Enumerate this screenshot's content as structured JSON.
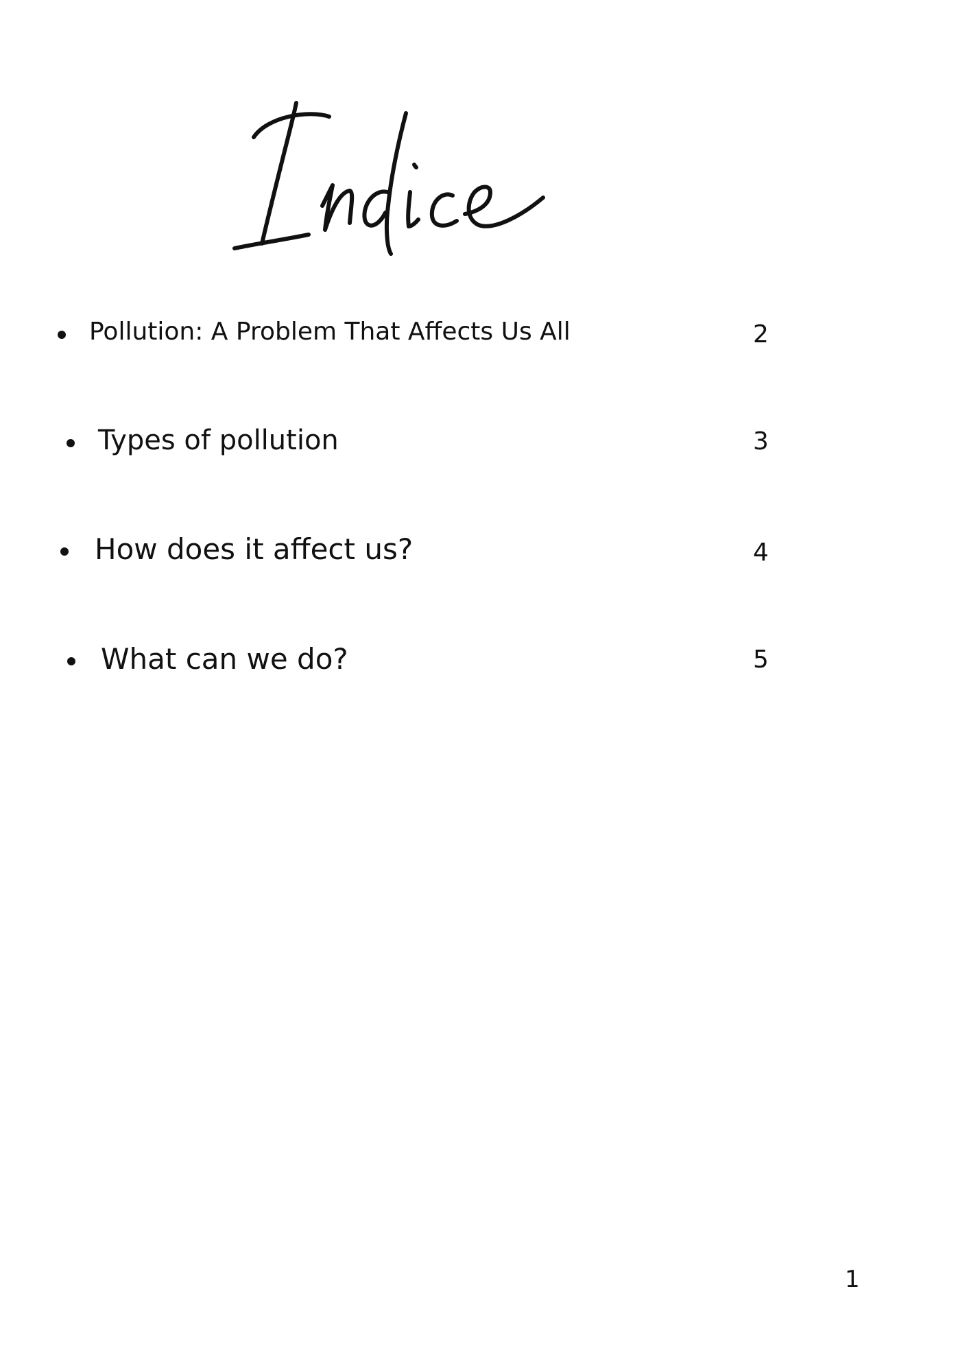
{
  "document": {
    "title": "Indice",
    "page_number": "1",
    "toc": [
      {
        "label": "Pollution: A Problem That Affects Us All",
        "page": "2"
      },
      {
        "label": "Types of pollution",
        "page": "3"
      },
      {
        "label": "How does it affect us?",
        "page": "4"
      },
      {
        "label": "What can we do?",
        "page": "5"
      }
    ]
  }
}
